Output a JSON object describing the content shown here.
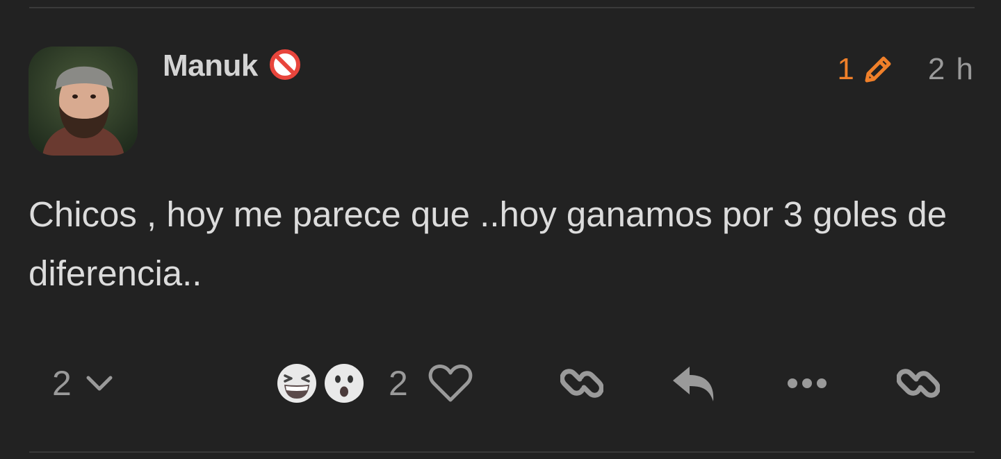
{
  "post": {
    "author": {
      "username": "Manuk"
    },
    "edit_count": "1",
    "time": "2 h",
    "content": "Chicos , hoy me parece que ..hoy ganamos por 3 goles de diferencia..",
    "replies_count": "2",
    "reactions": [
      "grinning-squinting-face",
      "astonished-face"
    ],
    "likes_count": "2"
  },
  "colors": {
    "background": "#222222",
    "accent": "#f0802a",
    "muted": "#9a9a9a",
    "text": "#dcdcdc"
  }
}
